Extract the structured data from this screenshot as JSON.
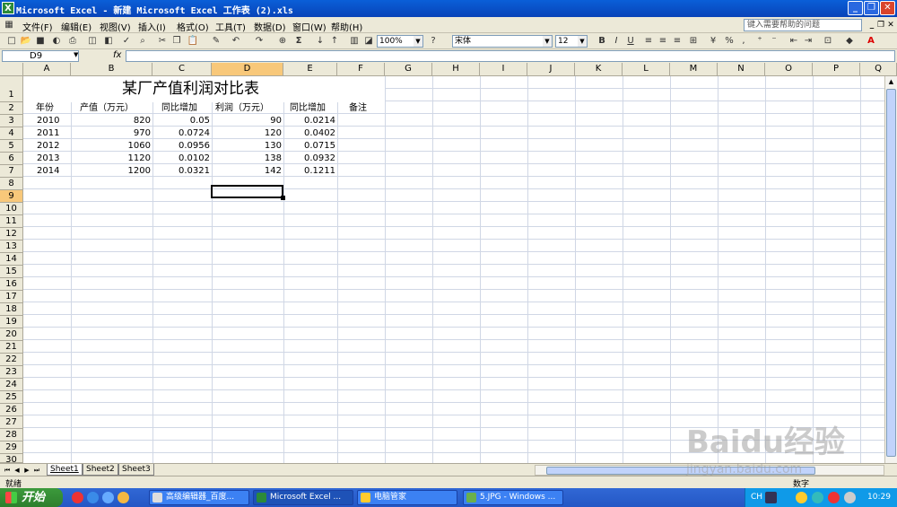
{
  "window": {
    "title": "Microsoft Excel - 新建 Microsoft Excel 工作表 (2).xls",
    "app_icon": "X"
  },
  "menu": {
    "items": [
      "文件(F)",
      "编辑(E)",
      "视图(V)",
      "插入(I)",
      "格式(O)",
      "工具(T)",
      "数据(D)",
      "窗口(W)",
      "帮助(H)"
    ],
    "help_placeholder": "键入需要帮助的问题"
  },
  "toolbar": {
    "zoom": "100%",
    "font": "宋体",
    "font_size": "12",
    "bold": "B",
    "italic": "I",
    "underline": "U",
    "percent": "%",
    "sigma": "Σ"
  },
  "formula_bar": {
    "name_box": "D9",
    "fx": "fx",
    "formula": ""
  },
  "columns": [
    "A",
    "B",
    "C",
    "D",
    "E",
    "F",
    "G",
    "H",
    "I",
    "J",
    "K",
    "L",
    "M",
    "N",
    "O",
    "P",
    "Q"
  ],
  "rows": [
    "1",
    "2",
    "3",
    "4",
    "5",
    "6",
    "7",
    "8",
    "9",
    "10",
    "11",
    "12",
    "13",
    "14",
    "15",
    "16",
    "17",
    "18",
    "19",
    "20",
    "21",
    "22",
    "23",
    "24",
    "25",
    "26",
    "27",
    "28",
    "29",
    "30"
  ],
  "sheet": {
    "title": "某厂产值利润对比表",
    "headers": [
      "年份",
      "产值（万元）",
      "同比增加",
      "利润（万元）",
      "同比增加",
      "备注"
    ],
    "data": [
      [
        "2010",
        "820",
        "0.05",
        "90",
        "0.0214"
      ],
      [
        "2011",
        "970",
        "0.0724",
        "120",
        "0.0402"
      ],
      [
        "2012",
        "1060",
        "0.0956",
        "130",
        "0.0715"
      ],
      [
        "2013",
        "1120",
        "0.0102",
        "138",
        "0.0932"
      ],
      [
        "2014",
        "1200",
        "0.0321",
        "142",
        "0.1211"
      ]
    ]
  },
  "tabs": [
    "Sheet1",
    "Sheet2",
    "Sheet3"
  ],
  "status": {
    "left": "就绪",
    "right": "数字"
  },
  "taskbar": {
    "start": "开始",
    "tasks": [
      "高级编辑器_百度...",
      "Microsoft Excel ...",
      "电脑管家",
      "5.JPG - Windows ..."
    ],
    "lang": "CH",
    "clock": "10:29"
  },
  "watermark": {
    "logo": "Baidu经验",
    "url": "jingyan.baidu.com"
  }
}
